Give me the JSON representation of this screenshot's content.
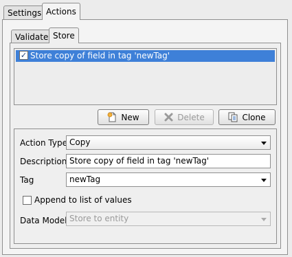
{
  "outer_tabs": [
    {
      "label": "Settings",
      "active": false
    },
    {
      "label": "Actions",
      "active": true
    }
  ],
  "inner_tabs": [
    {
      "label": "Validate",
      "active": false
    },
    {
      "label": "Store",
      "active": true
    }
  ],
  "actions_list": {
    "items": [
      {
        "label": "Store copy of field in tag 'newTag'",
        "checked": true,
        "selected": true
      }
    ]
  },
  "buttons": {
    "new": {
      "label": "New",
      "icon": "new-document-icon",
      "enabled": true
    },
    "delete": {
      "label": "Delete",
      "icon": "delete-x-icon",
      "enabled": false
    },
    "clone": {
      "label": "Clone",
      "icon": "clone-icon",
      "enabled": true
    }
  },
  "form": {
    "action_type": {
      "label": "Action Type",
      "value": "Copy"
    },
    "description": {
      "label": "Description",
      "value": "Store copy of field in tag 'newTag'"
    },
    "tag": {
      "label": "Tag",
      "value": "newTag"
    },
    "append": {
      "label": "Append to list of values",
      "checked": false
    },
    "data_model": {
      "label": "Data Model",
      "value": "Store to entity",
      "enabled": false
    }
  },
  "colors": {
    "selection": "#3e80d8",
    "panel": "#f4f4f4",
    "border": "#8e8e8e"
  }
}
